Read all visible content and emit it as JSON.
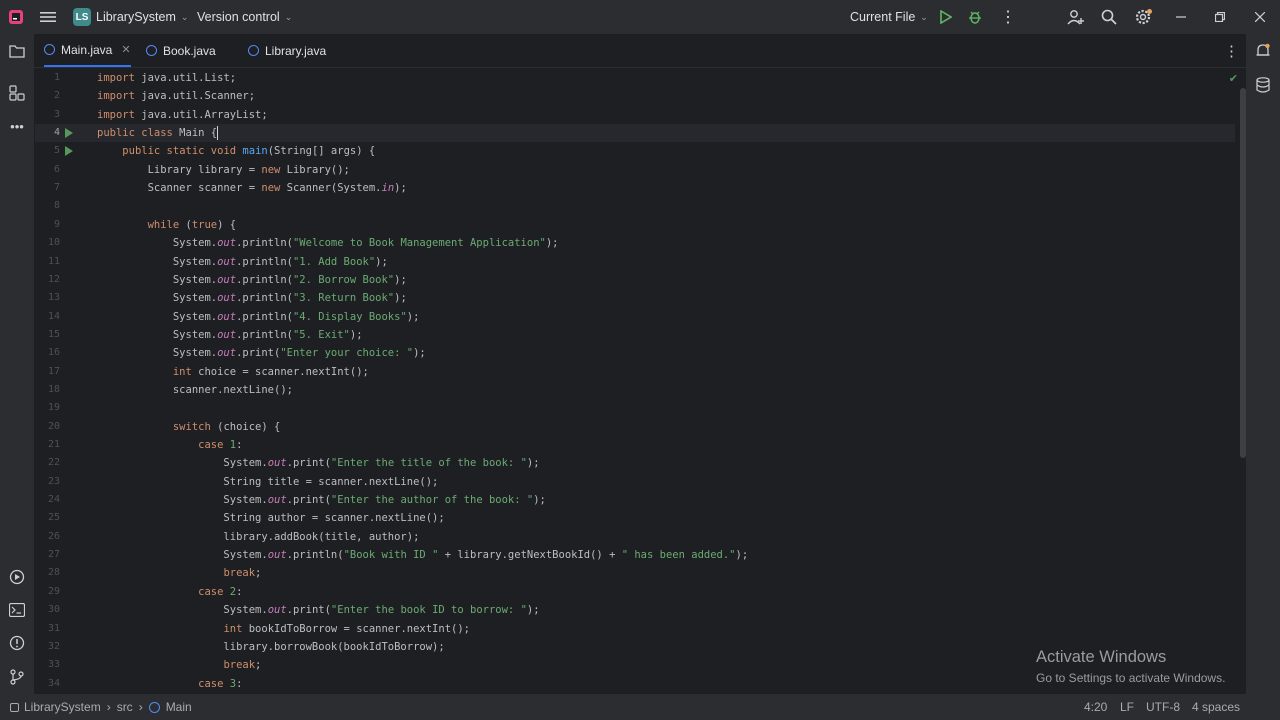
{
  "titlebar": {
    "project_badge": "LS",
    "project_name": "LibrarySystem",
    "vcs": "Version control",
    "run_config": "Current File"
  },
  "tabs": [
    {
      "label": "Main.java",
      "active": true
    },
    {
      "label": "Book.java",
      "active": false
    },
    {
      "label": "Library.java",
      "active": false
    }
  ],
  "editor": {
    "caret_line": 4,
    "lines": [
      {
        "n": "1",
        "c": [
          [
            "k",
            "import"
          ],
          [
            "t",
            " java.util.List;"
          ]
        ]
      },
      {
        "n": "2",
        "c": [
          [
            "k",
            "import"
          ],
          [
            "t",
            " java.util.Scanner;"
          ]
        ]
      },
      {
        "n": "3",
        "c": [
          [
            "k",
            "import"
          ],
          [
            "t",
            " java.util.ArrayList;"
          ]
        ]
      },
      {
        "n": "4",
        "c": [
          [
            "k",
            "public class"
          ],
          [
            "t",
            " Main "
          ],
          [
            "t",
            "{"
          ]
        ]
      },
      {
        "n": "5",
        "c": [
          [
            "t",
            "    "
          ],
          [
            "k",
            "public static void"
          ],
          [
            "t",
            " "
          ],
          [
            "f",
            "main"
          ],
          [
            "t",
            "(String[] args) {"
          ]
        ]
      },
      {
        "n": "6",
        "c": [
          [
            "t",
            "        Library library = "
          ],
          [
            "k",
            "new"
          ],
          [
            "t",
            " Library();"
          ]
        ]
      },
      {
        "n": "7",
        "c": [
          [
            "t",
            "        Scanner scanner = "
          ],
          [
            "k",
            "new"
          ],
          [
            "t",
            " Scanner(System."
          ],
          [
            "p",
            "in"
          ],
          [
            "t",
            ");"
          ]
        ]
      },
      {
        "n": "8",
        "c": []
      },
      {
        "n": "9",
        "c": [
          [
            "t",
            "        "
          ],
          [
            "k",
            "while"
          ],
          [
            "t",
            " ("
          ],
          [
            "k",
            "true"
          ],
          [
            "t",
            ") {"
          ]
        ]
      },
      {
        "n": "10",
        "c": [
          [
            "t",
            "            System."
          ],
          [
            "p",
            "out"
          ],
          [
            "t",
            ".println("
          ],
          [
            "s",
            "\"Welcome to Book Management Application\""
          ],
          [
            "t",
            ");"
          ]
        ]
      },
      {
        "n": "11",
        "c": [
          [
            "t",
            "            System."
          ],
          [
            "p",
            "out"
          ],
          [
            "t",
            ".println("
          ],
          [
            "s",
            "\"1. Add Book\""
          ],
          [
            "t",
            ");"
          ]
        ]
      },
      {
        "n": "12",
        "c": [
          [
            "t",
            "            System."
          ],
          [
            "p",
            "out"
          ],
          [
            "t",
            ".println("
          ],
          [
            "s",
            "\"2. Borrow Book\""
          ],
          [
            "t",
            ");"
          ]
        ]
      },
      {
        "n": "13",
        "c": [
          [
            "t",
            "            System."
          ],
          [
            "p",
            "out"
          ],
          [
            "t",
            ".println("
          ],
          [
            "s",
            "\"3. Return Book\""
          ],
          [
            "t",
            ");"
          ]
        ]
      },
      {
        "n": "14",
        "c": [
          [
            "t",
            "            System."
          ],
          [
            "p",
            "out"
          ],
          [
            "t",
            ".println("
          ],
          [
            "s",
            "\"4. Display Books\""
          ],
          [
            "t",
            ");"
          ]
        ]
      },
      {
        "n": "15",
        "c": [
          [
            "t",
            "            System."
          ],
          [
            "p",
            "out"
          ],
          [
            "t",
            ".println("
          ],
          [
            "s",
            "\"5. Exit\""
          ],
          [
            "t",
            ");"
          ]
        ]
      },
      {
        "n": "16",
        "c": [
          [
            "t",
            "            System."
          ],
          [
            "p",
            "out"
          ],
          [
            "t",
            ".print("
          ],
          [
            "s",
            "\"Enter your choice: \""
          ],
          [
            "t",
            ");"
          ]
        ]
      },
      {
        "n": "17",
        "c": [
          [
            "t",
            "            "
          ],
          [
            "k",
            "int"
          ],
          [
            "t",
            " choice = scanner.nextInt();"
          ]
        ]
      },
      {
        "n": "18",
        "c": [
          [
            "t",
            "            scanner.nextLine();"
          ]
        ]
      },
      {
        "n": "19",
        "c": []
      },
      {
        "n": "20",
        "c": [
          [
            "t",
            "            "
          ],
          [
            "k",
            "switch"
          ],
          [
            "t",
            " (choice) {"
          ]
        ]
      },
      {
        "n": "21",
        "c": [
          [
            "t",
            "                "
          ],
          [
            "k",
            "case"
          ],
          [
            "t",
            " "
          ],
          [
            "s",
            "1"
          ],
          [
            "t",
            ":"
          ]
        ]
      },
      {
        "n": "22",
        "c": [
          [
            "t",
            "                    System."
          ],
          [
            "p",
            "out"
          ],
          [
            "t",
            ".print("
          ],
          [
            "s",
            "\"Enter the title of the book: \""
          ],
          [
            "t",
            ");"
          ]
        ]
      },
      {
        "n": "23",
        "c": [
          [
            "t",
            "                    String title = scanner.nextLine();"
          ]
        ]
      },
      {
        "n": "24",
        "c": [
          [
            "t",
            "                    System."
          ],
          [
            "p",
            "out"
          ],
          [
            "t",
            ".print("
          ],
          [
            "s",
            "\"Enter the author of the book: \""
          ],
          [
            "t",
            ");"
          ]
        ]
      },
      {
        "n": "25",
        "c": [
          [
            "t",
            "                    String author = scanner.nextLine();"
          ]
        ]
      },
      {
        "n": "26",
        "c": [
          [
            "t",
            "                    library.addBook(title, author);"
          ]
        ]
      },
      {
        "n": "27",
        "c": [
          [
            "t",
            "                    System."
          ],
          [
            "p",
            "out"
          ],
          [
            "t",
            ".println("
          ],
          [
            "s",
            "\"Book with ID \""
          ],
          [
            "t",
            " + library.getNextBookId() + "
          ],
          [
            "s",
            "\" has been added.\""
          ],
          [
            "t",
            ");"
          ]
        ]
      },
      {
        "n": "28",
        "c": [
          [
            "t",
            "                    "
          ],
          [
            "k",
            "break"
          ],
          [
            "t",
            ";"
          ]
        ]
      },
      {
        "n": "29",
        "c": [
          [
            "t",
            "                "
          ],
          [
            "k",
            "case"
          ],
          [
            "t",
            " "
          ],
          [
            "s",
            "2"
          ],
          [
            "t",
            ":"
          ]
        ]
      },
      {
        "n": "30",
        "c": [
          [
            "t",
            "                    System."
          ],
          [
            "p",
            "out"
          ],
          [
            "t",
            ".print("
          ],
          [
            "s",
            "\"Enter the book ID to borrow: \""
          ],
          [
            "t",
            ");"
          ]
        ]
      },
      {
        "n": "31",
        "c": [
          [
            "t",
            "                    "
          ],
          [
            "k",
            "int"
          ],
          [
            "t",
            " bookIdToBorrow = scanner.nextInt();"
          ]
        ]
      },
      {
        "n": "32",
        "c": [
          [
            "t",
            "                    library.borrowBook(bookIdToBorrow);"
          ]
        ]
      },
      {
        "n": "33",
        "c": [
          [
            "t",
            "                    "
          ],
          [
            "k",
            "break"
          ],
          [
            "t",
            ";"
          ]
        ]
      },
      {
        "n": "34",
        "c": [
          [
            "t",
            "                "
          ],
          [
            "k",
            "case"
          ],
          [
            "t",
            " "
          ],
          [
            "s",
            "3"
          ],
          [
            "t",
            ":"
          ]
        ]
      }
    ]
  },
  "statusbar": {
    "breadcrumb": [
      "LibrarySystem",
      "src",
      "Main"
    ],
    "position": "4:20",
    "line_ending": "LF",
    "encoding": "UTF-8",
    "indent": "4 spaces"
  },
  "watermark": {
    "title": "Activate Windows",
    "subtitle": "Go to Settings to activate Windows."
  }
}
